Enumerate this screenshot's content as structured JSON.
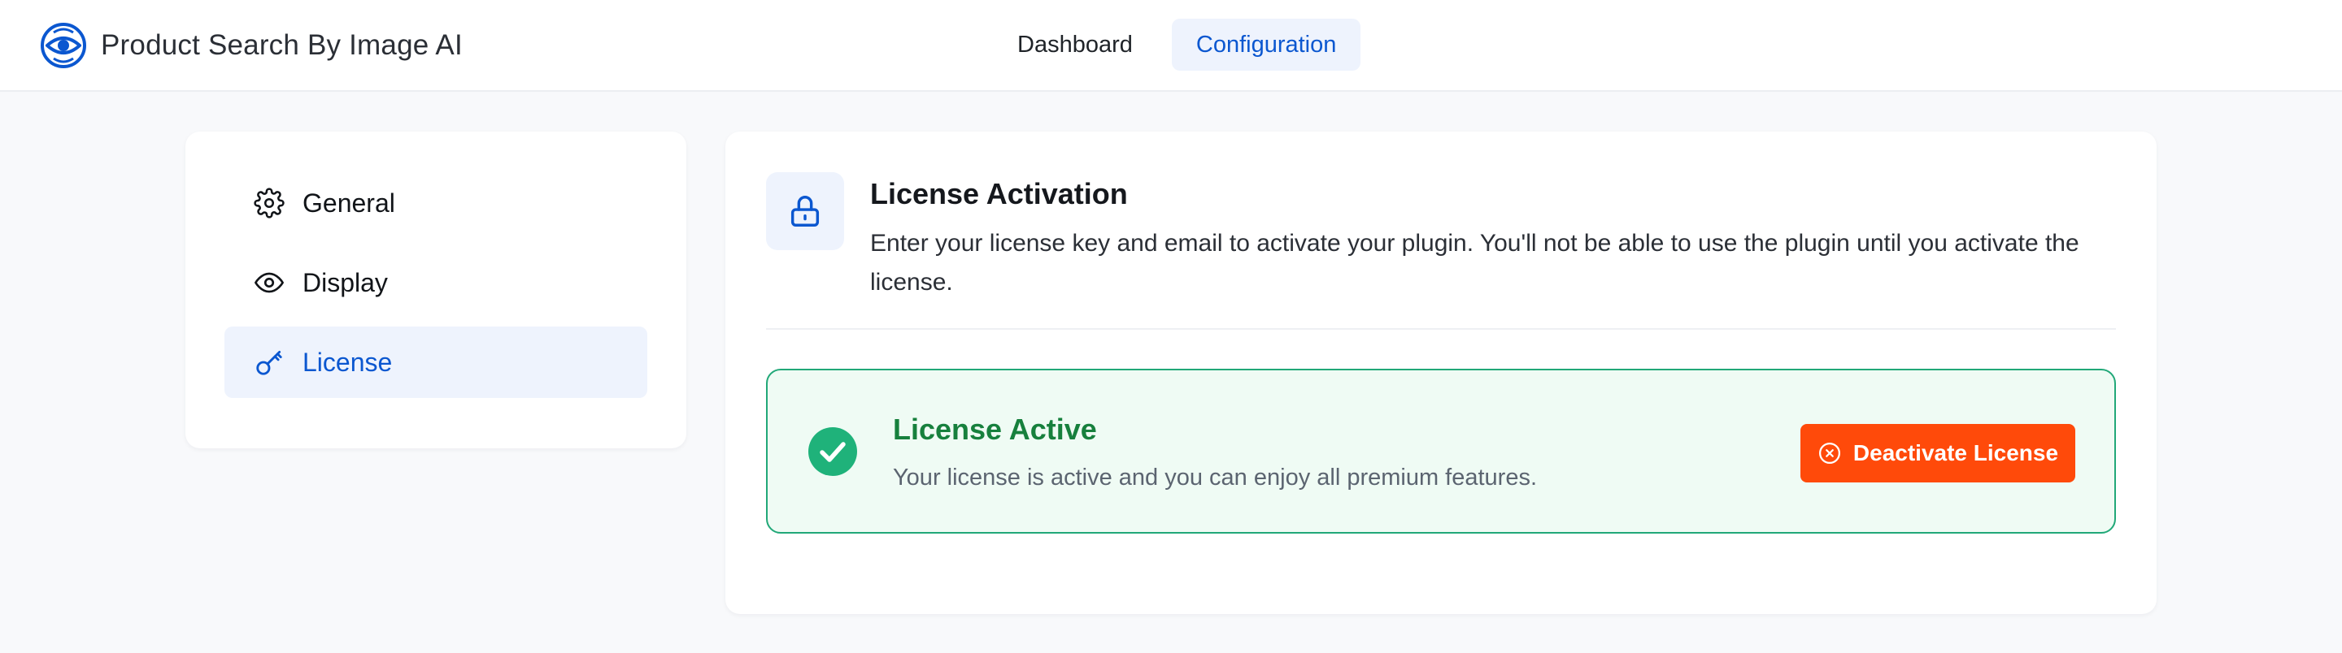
{
  "app": {
    "title": "Product Search By Image AI",
    "logo_icon": "eye-search-logo-icon",
    "accent_color": "#0b57d0"
  },
  "nav": {
    "tabs": [
      {
        "label": "Dashboard",
        "active": false
      },
      {
        "label": "Configuration",
        "active": true
      }
    ]
  },
  "sidebar": {
    "items": [
      {
        "label": "General",
        "icon": "gear-icon",
        "active": false
      },
      {
        "label": "Display",
        "icon": "eye-icon",
        "active": false
      },
      {
        "label": "License",
        "icon": "key-icon",
        "active": true
      }
    ]
  },
  "license": {
    "icon": "lock-icon",
    "title": "License Activation",
    "description": "Enter your license key and email to activate your plugin. You'll not be able to use the plugin until you activate the license.",
    "status": {
      "icon": "check-circle-icon",
      "title": "License Active",
      "message": "Your license is active and you can enjoy all premium features.",
      "color": "#17803d"
    },
    "deactivate_button": {
      "label": "Deactivate License",
      "icon": "x-circle-icon",
      "color": "#ff4a0a"
    }
  }
}
